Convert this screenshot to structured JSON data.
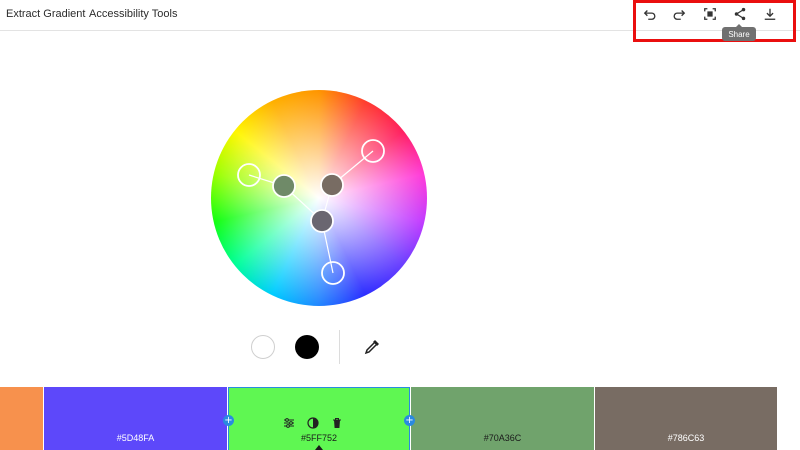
{
  "nav": {
    "extract_gradient": "Extract Gradient",
    "accessibility_tools": "Accessibility Tools"
  },
  "toolbar": {
    "items": [
      {
        "icon": "undo-icon"
      },
      {
        "icon": "redo-icon"
      },
      {
        "icon": "fullscreen-icon"
      },
      {
        "icon": "share-icon"
      },
      {
        "icon": "download-icon"
      }
    ],
    "tooltip": "Share",
    "highlight_color": "#ea0f0f"
  },
  "color_wheel": {
    "base_swatch_color": "#786C63"
  },
  "palette": {
    "swatches": [
      {
        "hex": "",
        "color": "#F7914D"
      },
      {
        "hex": "#5D48FA",
        "color": "#5D48FA"
      },
      {
        "hex": "#5FF752",
        "color": "#5FF752",
        "selected": true
      },
      {
        "hex": "#70A36C",
        "color": "#70A36C"
      },
      {
        "hex": "#786C63",
        "color": "#786C63"
      }
    ],
    "selected_tools": [
      "adjust-icon",
      "contrast-icon",
      "trash-icon"
    ]
  },
  "bottom_controls": {
    "swatch_white": "#FFFFFF",
    "swatch_black": "#000000"
  }
}
